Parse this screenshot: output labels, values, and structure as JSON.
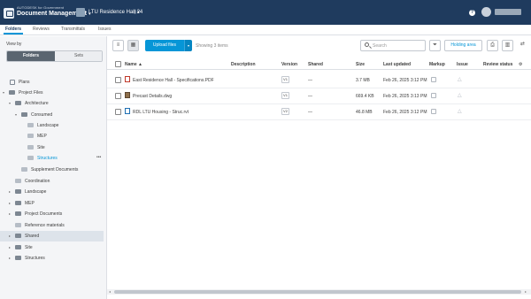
{
  "header": {
    "brand": "AUTODESK for Government",
    "product": "Document Management",
    "project": "LTU Residence Hall 24",
    "help": "?"
  },
  "tabs": [
    "Folders",
    "Reviews",
    "Transmittals",
    "Issues"
  ],
  "left": {
    "view_by": "View by",
    "seg_folders": "Folders",
    "seg_sets": "Sets",
    "tree": [
      {
        "label": "Plans"
      },
      {
        "label": "Project Files"
      },
      {
        "label": "Architecture"
      },
      {
        "label": "Consumed"
      },
      {
        "label": "Landscape"
      },
      {
        "label": "MEP"
      },
      {
        "label": "Site"
      },
      {
        "label": "Structures"
      },
      {
        "label": "Supplement Documents"
      },
      {
        "label": "Coordination"
      },
      {
        "label": "Landscape"
      },
      {
        "label": "MEP"
      },
      {
        "label": "Project Documents"
      },
      {
        "label": "Reference materials"
      },
      {
        "label": "Shared"
      },
      {
        "label": "Site"
      },
      {
        "label": "Structures"
      }
    ],
    "more": "•••"
  },
  "toolbar": {
    "upload": "Upload files",
    "showing": "Showing 3 items",
    "search_placeholder": "Search",
    "holding": "Holding area"
  },
  "table": {
    "columns": [
      "Name ▲",
      "Description",
      "Version",
      "Shared",
      "Size",
      "Last updated",
      "Markup",
      "Issue",
      "Review status"
    ],
    "rows": [
      {
        "name": "East Residence Hall - Specifications.PDF",
        "version": "V1",
        "shared": "—",
        "size": "3.7 MB",
        "updated": "Feb 26, 2025 3:12 PM"
      },
      {
        "name": "Precast Details.dwg",
        "version": "V1",
        "shared": "—",
        "size": "669.4 KB",
        "updated": "Feb 26, 2025 3:13 PM"
      },
      {
        "name": "RDL LTU Housing - Struc.rvt",
        "version": "V2",
        "shared": "—",
        "size": "46.8 MB",
        "updated": "Feb 26, 2025 3:12 PM"
      }
    ]
  },
  "colors": {
    "topbar": "#1f3b5e",
    "accent": "#0696d7"
  }
}
